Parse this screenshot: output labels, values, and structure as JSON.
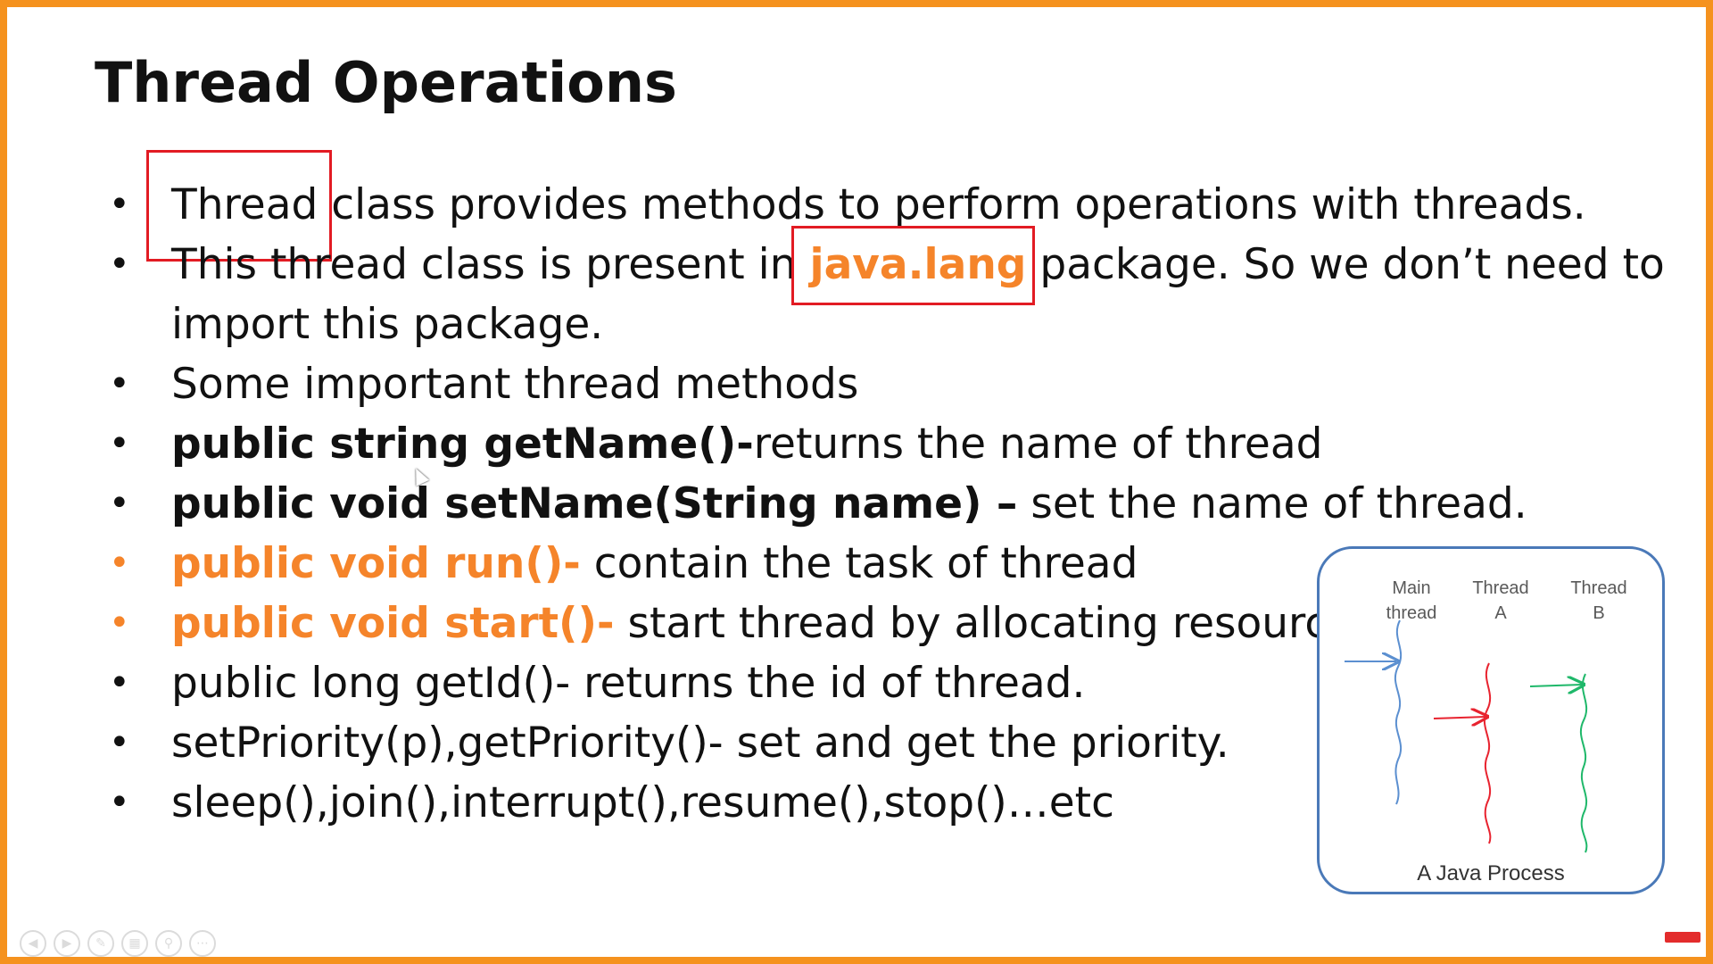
{
  "slide": {
    "title": "Thread Operations",
    "bullets": [
      {
        "boxed": "Thread",
        "text": " class provides methods to perform operations with threads."
      },
      {
        "text_before": "This thread class is present in ",
        "boxed_highlight": "java.lang",
        "text_after": " package. So we don’t need to",
        "text_wrap": "import this package."
      },
      {
        "text": "Some important thread methods"
      },
      {
        "strong": "public string getName()-",
        "text": "returns the name of thread"
      },
      {
        "strong": "public void setName(String name) –",
        "text": " set the name of thread."
      },
      {
        "highlight": "public void run()-",
        "text": " contain the task of thread"
      },
      {
        "highlight": "public void start()-",
        "text": " start thread by allocating resources."
      },
      {
        "text": "public long getId()- returns the id of thread."
      },
      {
        "text": "setPriority(p),getPriority()- set and get the priority."
      },
      {
        "text": "sleep(),join(),interrupt(),resume(),stop()…etc"
      }
    ],
    "bullet_symbol": "•"
  },
  "diagram": {
    "columns": [
      {
        "line1": "Main",
        "line2": "thread",
        "color": "#5b8fd0"
      },
      {
        "line1": "Thread",
        "line2": "A",
        "color": "#e8232f"
      },
      {
        "line1": "Thread",
        "line2": "B",
        "color": "#1fb86a"
      }
    ],
    "caption": "A Java Process"
  },
  "colors": {
    "frame": "#f5921e",
    "highlight": "#f5842a",
    "box": "#e21b23",
    "diagram_border": "#4a79b8"
  },
  "icons": [
    "prev-icon",
    "next-icon",
    "pen-icon",
    "slides-icon",
    "zoom-icon",
    "more-icon"
  ]
}
